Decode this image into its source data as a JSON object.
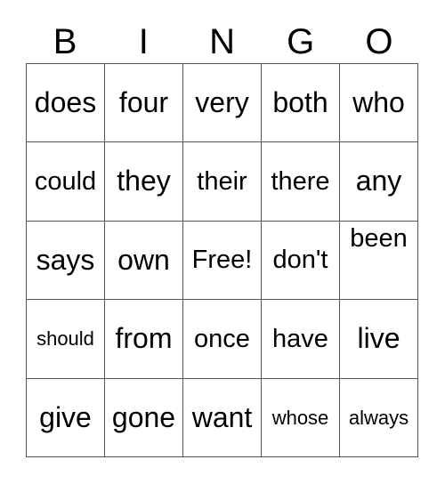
{
  "card": {
    "title": "BINGO",
    "columns": 5,
    "rows": 5
  },
  "header": {
    "letters": [
      "B",
      "I",
      "N",
      "G",
      "O"
    ]
  },
  "colors": {
    "background": "#ffffff",
    "text": "#000000",
    "grid_line": "#555555"
  },
  "grid": {
    "cells": [
      {
        "text": "does",
        "size": "lg",
        "align": "center"
      },
      {
        "text": "four",
        "size": "lg",
        "align": "center"
      },
      {
        "text": "very",
        "size": "lg",
        "align": "center"
      },
      {
        "text": "both",
        "size": "lg",
        "align": "center"
      },
      {
        "text": "who",
        "size": "lg",
        "align": "center"
      },
      {
        "text": "could",
        "size": "md",
        "align": "center"
      },
      {
        "text": "they",
        "size": "lg",
        "align": "center"
      },
      {
        "text": "their",
        "size": "md",
        "align": "center"
      },
      {
        "text": "there",
        "size": "md",
        "align": "center"
      },
      {
        "text": "any",
        "size": "lg",
        "align": "center"
      },
      {
        "text": "says",
        "size": "lg",
        "align": "center"
      },
      {
        "text": "own",
        "size": "lg",
        "align": "center"
      },
      {
        "text": "Free!",
        "size": "md",
        "align": "center"
      },
      {
        "text": "don't",
        "size": "md",
        "align": "center"
      },
      {
        "text": "been",
        "size": "md",
        "align": "top"
      },
      {
        "text": "should",
        "size": "sm",
        "align": "center"
      },
      {
        "text": "from",
        "size": "lg",
        "align": "center"
      },
      {
        "text": "once",
        "size": "md",
        "align": "center"
      },
      {
        "text": "have",
        "size": "md",
        "align": "center"
      },
      {
        "text": "live",
        "size": "lg",
        "align": "center"
      },
      {
        "text": "give",
        "size": "lg",
        "align": "center"
      },
      {
        "text": "gone",
        "size": "lg",
        "align": "center"
      },
      {
        "text": "want",
        "size": "lg",
        "align": "center"
      },
      {
        "text": "whose",
        "size": "sm",
        "align": "center"
      },
      {
        "text": "always",
        "size": "sm",
        "align": "center"
      }
    ]
  }
}
